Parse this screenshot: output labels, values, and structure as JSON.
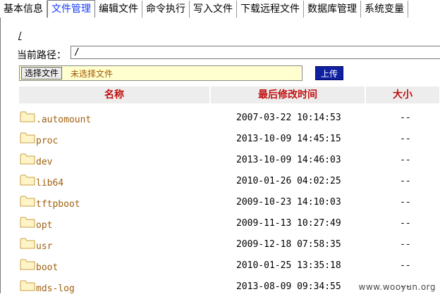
{
  "tabs": [
    {
      "label": "基本信息",
      "active": false
    },
    {
      "label": "文件管理",
      "active": true
    },
    {
      "label": "编辑文件",
      "active": false
    },
    {
      "label": "命令执行",
      "active": false
    },
    {
      "label": "写入文件",
      "active": false
    },
    {
      "label": "下载远程文件",
      "active": false
    },
    {
      "label": "数据库管理",
      "active": false
    },
    {
      "label": "系统变量",
      "active": false
    }
  ],
  "root_link": "/",
  "path": {
    "label": "当前路径：",
    "value": "/"
  },
  "upload": {
    "choose_label": "选择文件",
    "no_file_text": "未选择文件",
    "upload_label": "上传"
  },
  "table": {
    "headers": {
      "name": "名称",
      "modified": "最后修改时间",
      "size": "大小"
    },
    "rows": [
      {
        "name": ".automount",
        "modified": "2007-03-22 10:14:53",
        "size": "--"
      },
      {
        "name": "proc",
        "modified": "2013-10-09 14:45:15",
        "size": "--"
      },
      {
        "name": "dev",
        "modified": "2013-10-09 14:46:03",
        "size": "--"
      },
      {
        "name": "lib64",
        "modified": "2010-01-26 04:02:25",
        "size": "--"
      },
      {
        "name": "tftpboot",
        "modified": "2009-10-23 14:10:03",
        "size": "--"
      },
      {
        "name": "opt",
        "modified": "2009-11-13 10:27:49",
        "size": "--"
      },
      {
        "name": "usr",
        "modified": "2009-12-18 07:58:35",
        "size": "--"
      },
      {
        "name": "boot",
        "modified": "2010-01-25 13:35:18",
        "size": "--"
      },
      {
        "name": "mds-log",
        "modified": "2013-08-09 09:34:55",
        "size": "--"
      }
    ]
  },
  "watermark": "www.wooyun.org",
  "colors": {
    "active_tab": "#1a3cff",
    "header_text": "#c01010",
    "folder_name": "#a06010",
    "upload_button": "#0f20a0"
  }
}
